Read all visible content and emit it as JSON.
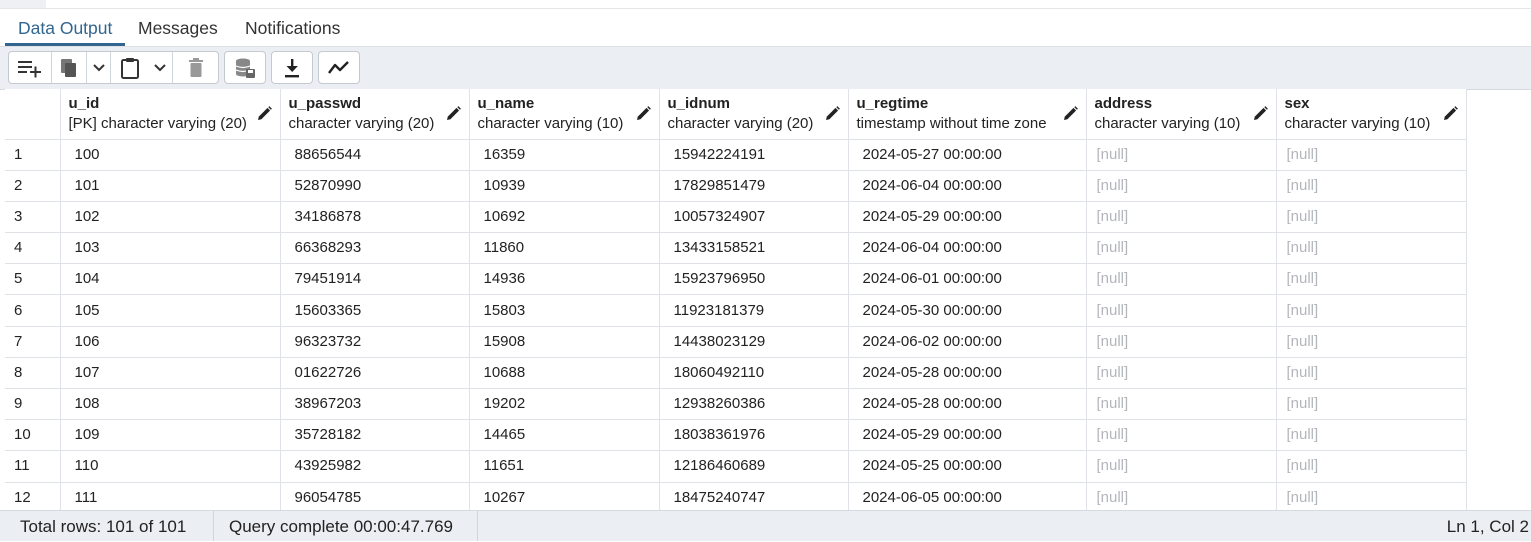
{
  "tabs": [
    {
      "label": "Data Output",
      "active": true
    },
    {
      "label": "Messages",
      "active": false
    },
    {
      "label": "Notifications",
      "active": false
    }
  ],
  "toolbar": {
    "icons": [
      "add-row-icon",
      "copy-icon",
      "chevron-down-icon",
      "paste-icon",
      "chevron-down-icon",
      "delete-icon",
      "save-data-icon",
      "download-icon",
      "graph-visualiser-icon"
    ]
  },
  "grid": {
    "columns": [
      {
        "name": "u_id",
        "type": "[PK] character varying (20)"
      },
      {
        "name": "u_passwd",
        "type": "character varying (20)"
      },
      {
        "name": "u_name",
        "type": "character varying (10)"
      },
      {
        "name": "u_idnum",
        "type": "character varying (20)"
      },
      {
        "name": "u_regtime",
        "type": "timestamp without time zone"
      },
      {
        "name": "address",
        "type": "character varying (10)"
      },
      {
        "name": "sex",
        "type": "character varying (10)"
      }
    ],
    "null_text": "[null]",
    "rows": [
      {
        "n": "1",
        "cells": [
          "100",
          "88656544",
          "16359",
          "15942224191",
          "2024-05-27 00:00:00",
          "[null]",
          "[null]"
        ]
      },
      {
        "n": "2",
        "cells": [
          "101",
          "52870990",
          "10939",
          "17829851479",
          "2024-06-04 00:00:00",
          "[null]",
          "[null]"
        ]
      },
      {
        "n": "3",
        "cells": [
          "102",
          "34186878",
          "10692",
          "10057324907",
          "2024-05-29 00:00:00",
          "[null]",
          "[null]"
        ]
      },
      {
        "n": "4",
        "cells": [
          "103",
          "66368293",
          "11860",
          "13433158521",
          "2024-06-04 00:00:00",
          "[null]",
          "[null]"
        ]
      },
      {
        "n": "5",
        "cells": [
          "104",
          "79451914",
          "14936",
          "15923796950",
          "2024-06-01 00:00:00",
          "[null]",
          "[null]"
        ]
      },
      {
        "n": "6",
        "cells": [
          "105",
          "15603365",
          "15803",
          "11923181379",
          "2024-05-30 00:00:00",
          "[null]",
          "[null]"
        ]
      },
      {
        "n": "7",
        "cells": [
          "106",
          "96323732",
          "15908",
          "14438023129",
          "2024-06-02 00:00:00",
          "[null]",
          "[null]"
        ]
      },
      {
        "n": "8",
        "cells": [
          "107",
          "01622726",
          "10688",
          "18060492110",
          "2024-05-28 00:00:00",
          "[null]",
          "[null]"
        ]
      },
      {
        "n": "9",
        "cells": [
          "108",
          "38967203",
          "19202",
          "12938260386",
          "2024-05-28 00:00:00",
          "[null]",
          "[null]"
        ]
      },
      {
        "n": "10",
        "cells": [
          "109",
          "35728182",
          "14465",
          "18038361976",
          "2024-05-29 00:00:00",
          "[null]",
          "[null]"
        ]
      },
      {
        "n": "11",
        "cells": [
          "110",
          "43925982",
          "11651",
          "12186460689",
          "2024-05-25 00:00:00",
          "[null]",
          "[null]"
        ]
      },
      {
        "n": "12",
        "cells": [
          "111",
          "96054785",
          "10267",
          "18475240747",
          "2024-06-05 00:00:00",
          "[null]",
          "[null]"
        ]
      }
    ]
  },
  "status": {
    "total_rows": "Total rows: 101 of 101",
    "query": "Query complete 00:00:47.769",
    "cursor": "Ln 1, Col 2"
  },
  "colors": {
    "accent": "#326690",
    "toolbar_bg": "#ebeef3",
    "null_text": "#b3b6bb"
  }
}
